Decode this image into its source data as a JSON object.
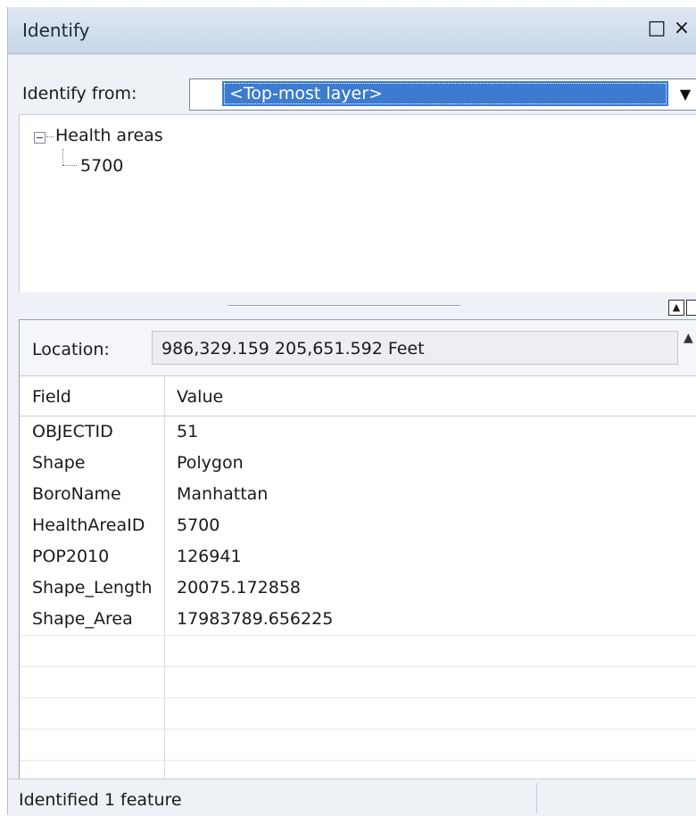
{
  "window": {
    "title": "Identify",
    "maximize_icon": "□",
    "close_icon": "×"
  },
  "identify_from": {
    "label": "Identify from:",
    "selected": "<Top-most layer>",
    "dropdown_icon": "▼"
  },
  "tree": {
    "expander_icon": "minus-box",
    "layer": "Health areas",
    "feature": "5700"
  },
  "location": {
    "label": "Location:",
    "value": "986,329.159  205,651.592 Feet"
  },
  "table": {
    "columns": [
      "Field",
      "Value"
    ],
    "rows": [
      {
        "field": "OBJECTID",
        "value": "51"
      },
      {
        "field": "Shape",
        "value": "Polygon"
      },
      {
        "field": "BoroName",
        "value": "Manhattan"
      },
      {
        "field": "HealthAreaID",
        "value": "5700"
      },
      {
        "field": "POP2010",
        "value": "126941"
      },
      {
        "field": "Shape_Length",
        "value": "20075.172858"
      },
      {
        "field": "Shape_Area",
        "value": "17983789.656225"
      }
    ]
  },
  "status": {
    "text": "Identified 1 feature"
  },
  "colors": {
    "title_bar": "#c8d6e7",
    "selection": "#3c7bcf",
    "panel": "#eef1f5"
  }
}
